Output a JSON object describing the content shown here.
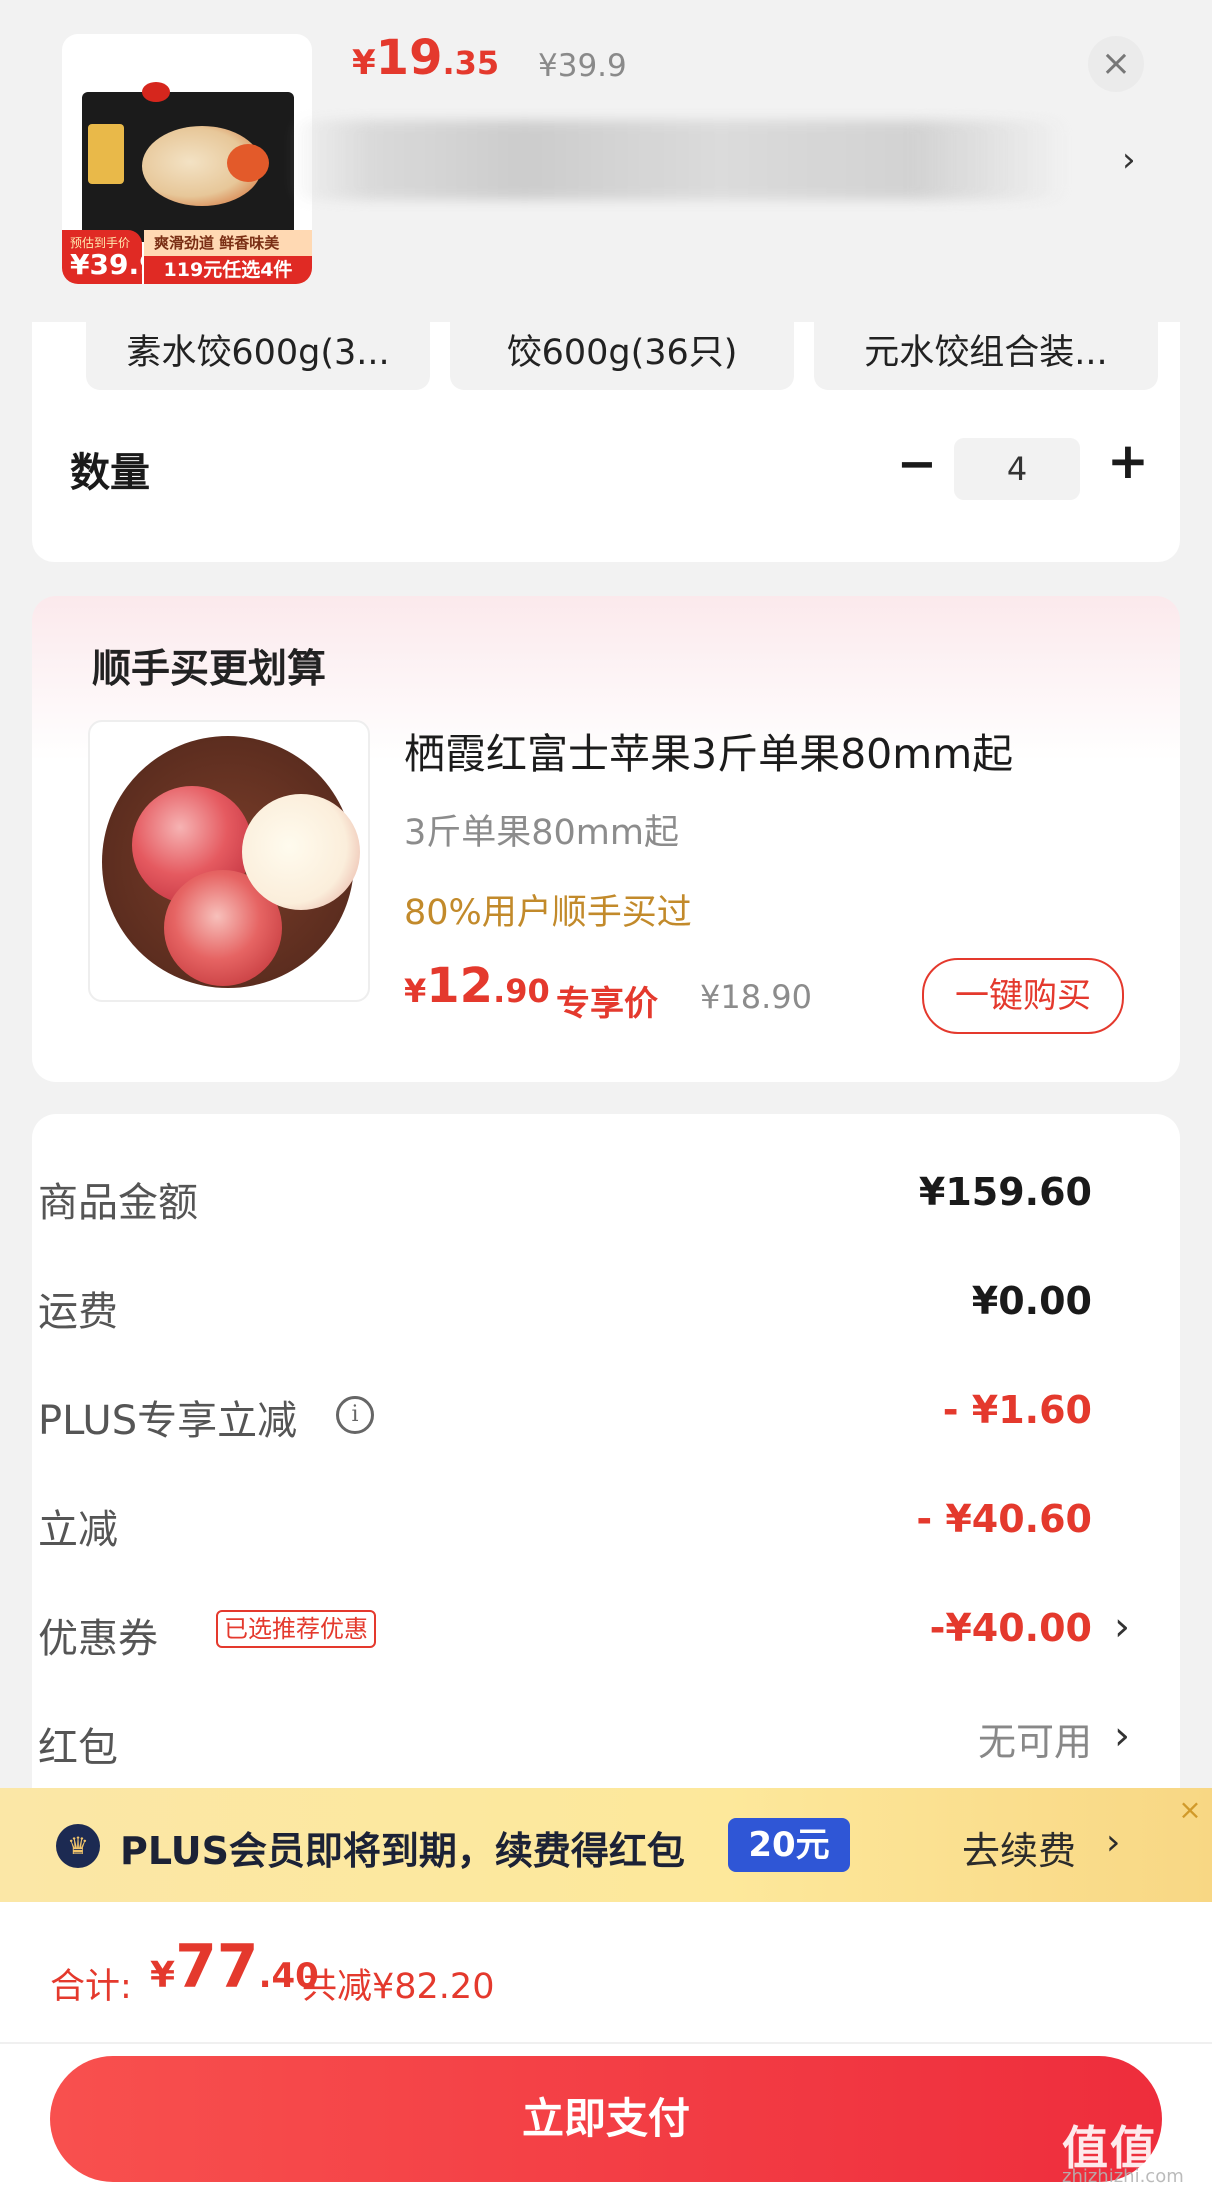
{
  "product": {
    "price_symbol": "¥",
    "price_int": "19",
    "price_dec": ".35",
    "original_price": "¥39.9",
    "close_icon": "×",
    "chevron": "›",
    "image_badge": {
      "estimate_label": "预估到手价",
      "estimate_price": "¥39.9",
      "tagline": "爽滑劲道 鲜香味美",
      "promo": "119元任选4件"
    }
  },
  "variants": [
    {
      "label": "素水饺600g(3..."
    },
    {
      "label": "饺600g(36只)"
    },
    {
      "label": "元水饺组合装..."
    }
  ],
  "quantity": {
    "label": "数量",
    "minus": "−",
    "value": "4",
    "plus": "+"
  },
  "recommend": {
    "title": "顺手买更划算",
    "name": "栖霞红富士苹果3斤单果80mm起",
    "spec": "3斤单果80mm起",
    "bought": "80%用户顺手买过",
    "price_symbol": "¥",
    "price_int": "12",
    "price_dec": ".90",
    "price_tag": "专享价",
    "original_price": "¥18.90",
    "buy_label": "一键购买"
  },
  "summary": {
    "rows": [
      {
        "label": "商品金额",
        "value": "¥159.60"
      },
      {
        "label": "运费",
        "value": "¥0.00"
      },
      {
        "label": "PLUS专享立减",
        "value": "- ¥1.60"
      },
      {
        "label": "立减",
        "value": "- ¥40.60"
      },
      {
        "label": "优惠券",
        "value": "-¥40.00",
        "tag": "已选推荐优惠"
      },
      {
        "label": "红包",
        "value": "无可用"
      }
    ],
    "chevron": "›",
    "info_icon": "i"
  },
  "plus_banner": {
    "text": "PLUS会员即将到期，续费得红包",
    "badge": "20元",
    "action": "去续费",
    "chevron": "›",
    "close": "×"
  },
  "footer": {
    "total_label": "合计:",
    "total_symbol": "¥",
    "total_int": "77",
    "total_dec": ".40",
    "saved": "共减¥82.20",
    "pay_label": "立即支付"
  },
  "watermark": {
    "text": "值值值",
    "site": "zhizhizhi.com"
  },
  "colors": {
    "accent_red": "#e4392d",
    "gold": "#c28a2b",
    "plus_blue": "#2f56d6"
  }
}
